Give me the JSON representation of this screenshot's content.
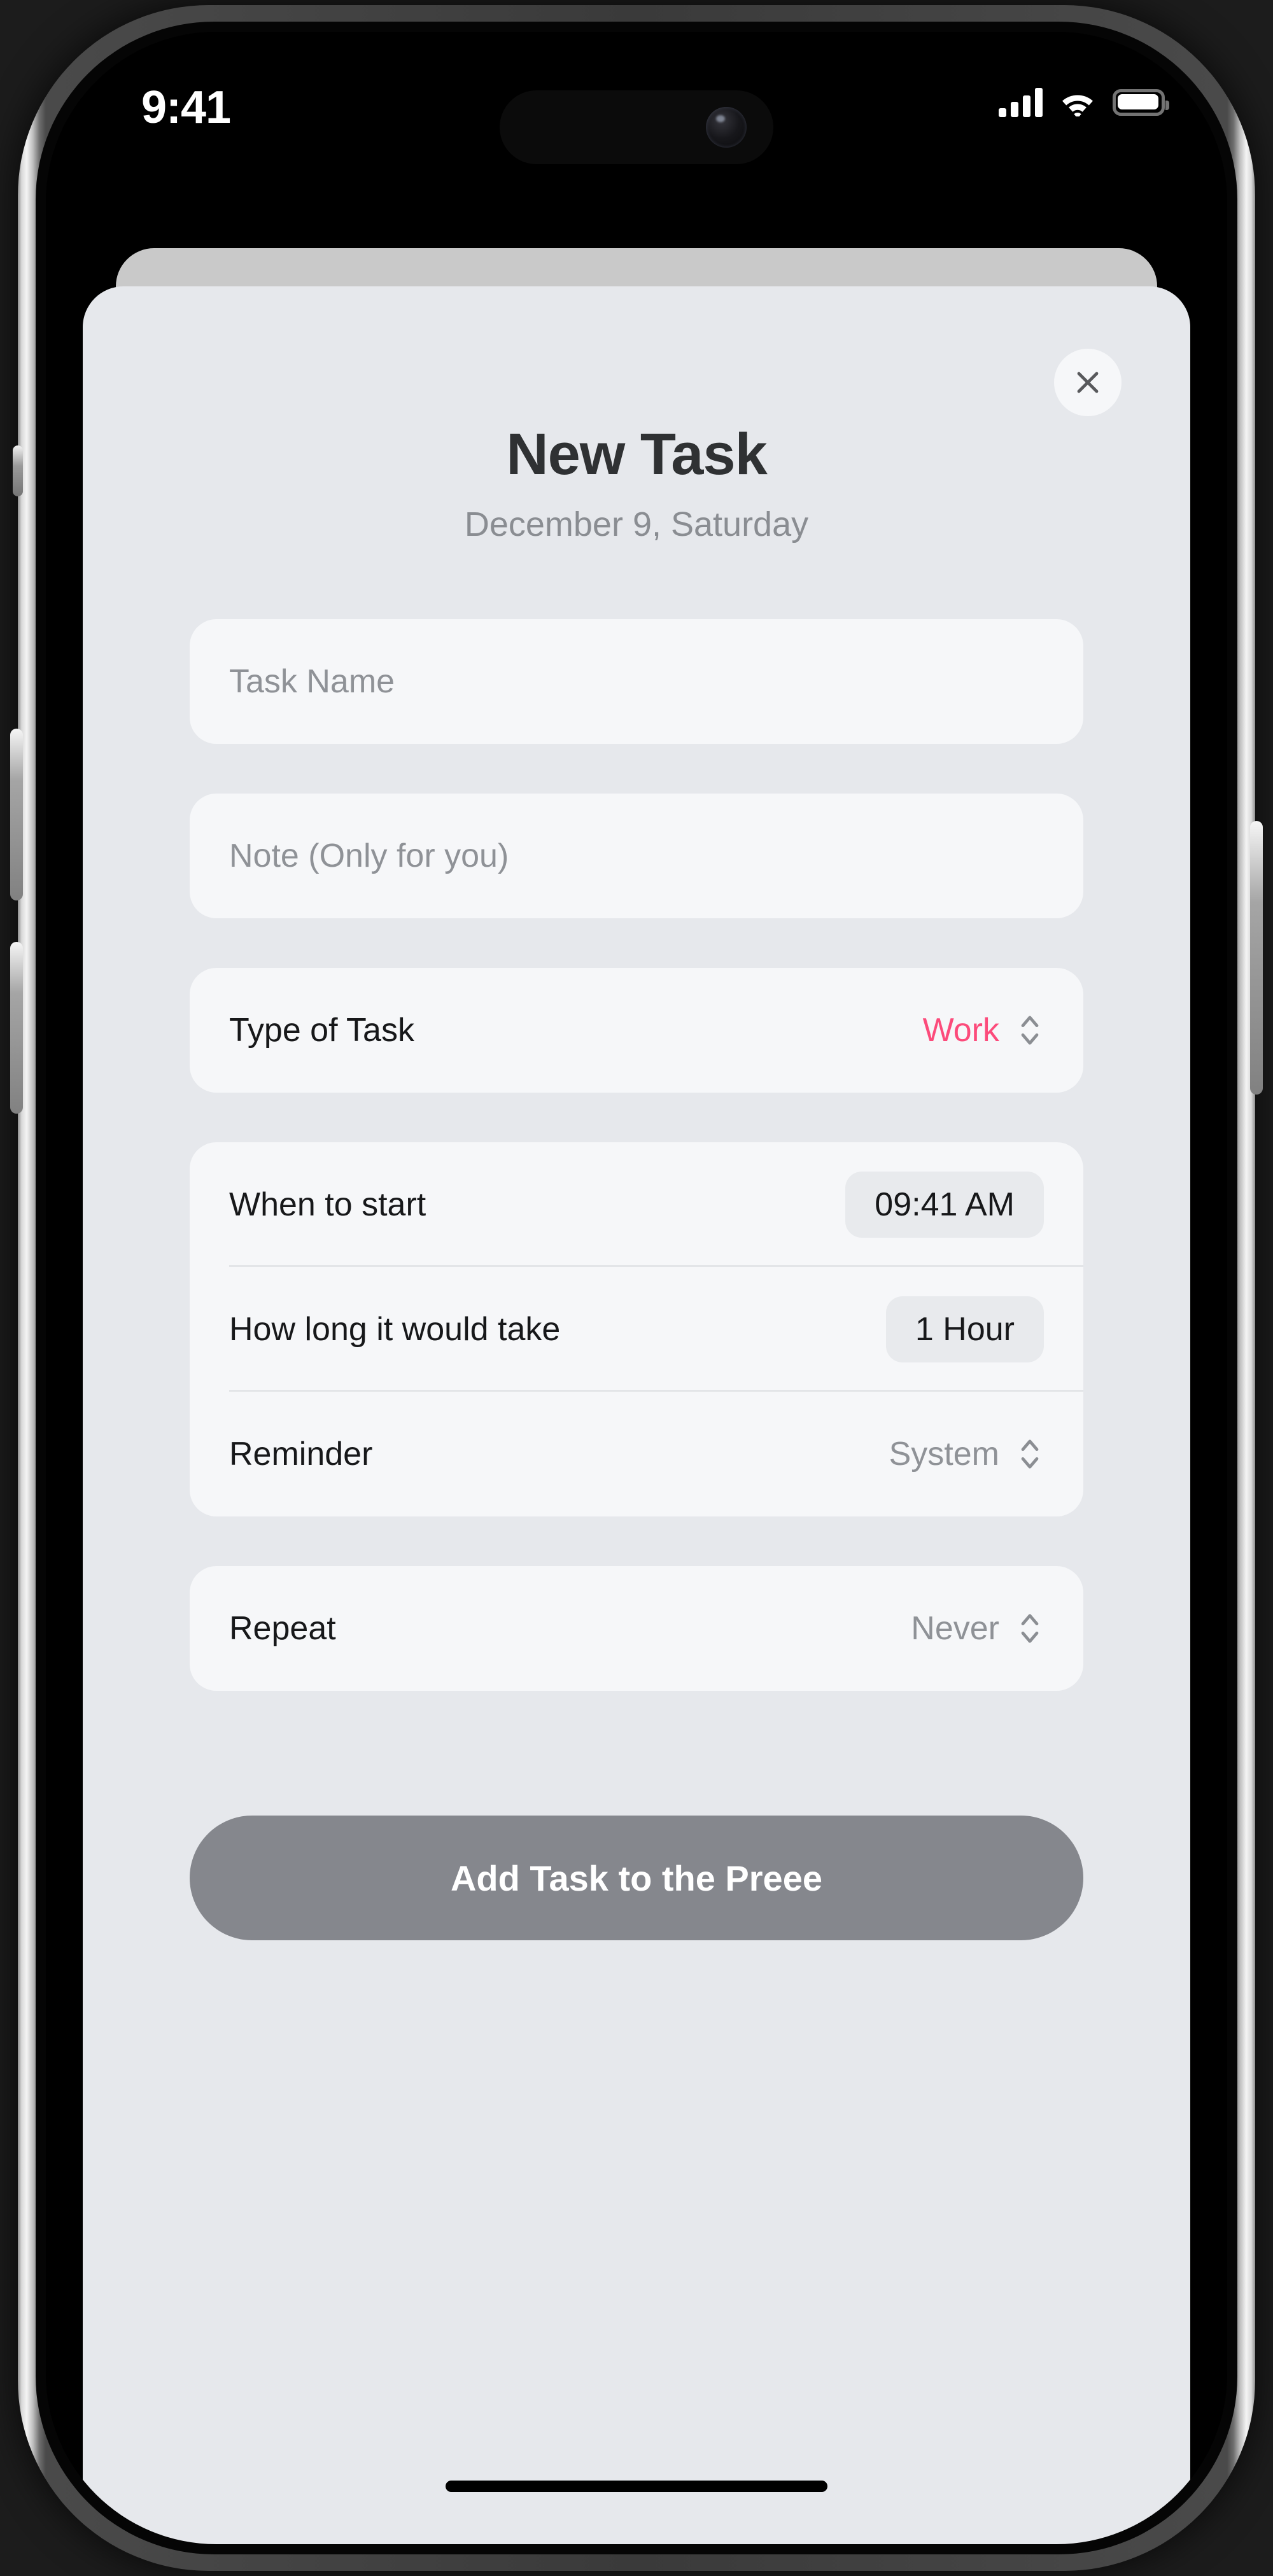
{
  "status_bar": {
    "time": "9:41",
    "icons": [
      "cellular-signal-icon",
      "wifi-icon",
      "battery-icon"
    ]
  },
  "sheet": {
    "title": "New Task",
    "subtitle": "December 9, Saturday",
    "close_label": "✕"
  },
  "fields": {
    "task_name_placeholder": "Task Name",
    "note_placeholder": "Note (Only for you)"
  },
  "type_group": {
    "label": "Type of Task",
    "value": "Work",
    "stepper_icon": "chevron-up-down-icon"
  },
  "schedule_group": {
    "rows": [
      {
        "label": "When to start",
        "value": "09:41 AM",
        "style": "pill"
      },
      {
        "label": "How long it would take",
        "value": "1 Hour",
        "style": "pill"
      },
      {
        "label": "Reminder",
        "value": "System",
        "style": "stepper"
      }
    ]
  },
  "repeat_group": {
    "label": "Repeat",
    "value": "Never",
    "stepper_icon": "chevron-up-down-icon"
  },
  "submit": {
    "label": "Add Task to the Preee"
  },
  "colors": {
    "accent_pink": "#fc4b7b",
    "sheet_bg": "#e6e8ec",
    "field_bg": "#f6f7f9",
    "pill_bg": "#e8eaed",
    "submit_bg": "#85878d",
    "muted_text": "#8f9297",
    "primary_text": "#17181a"
  }
}
